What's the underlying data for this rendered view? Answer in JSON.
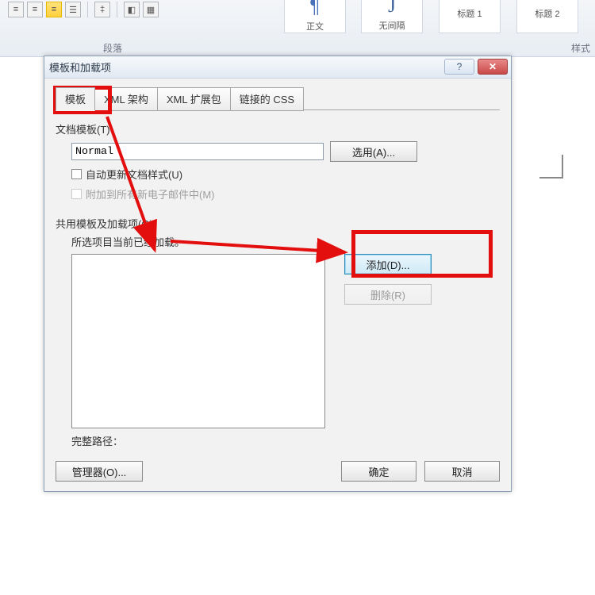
{
  "ribbon": {
    "group_paragraph": "段落",
    "group_style": "样式",
    "style_normal": "正文",
    "style_nospacing": "无间隔",
    "style_h1": "标题 1",
    "style_h2": "标题 2"
  },
  "dialog": {
    "title": "模板和加载项",
    "help_icon": "?",
    "close_icon": "✕",
    "tabs": {
      "template": "模板",
      "xml_schema": "XML 架构",
      "xml_expand": "XML 扩展包",
      "linked_css": "链接的 CSS"
    },
    "doc_template_label": "文档模板(T)",
    "doc_template_value": "Normal",
    "select_button": "选用(A)...",
    "auto_update_label": "自动更新文档样式(U)",
    "attach_mail_label": "附加到所有新电子邮件中(M)",
    "shared_label": "共用模板及加载项(G)",
    "loaded_note": "所选项目当前已经加载。",
    "add_button": "添加(D)...",
    "remove_button": "删除(R)",
    "full_path_label": "完整路径：",
    "organizer_button": "管理器(O)...",
    "ok_button": "确定",
    "cancel_button": "取消"
  }
}
